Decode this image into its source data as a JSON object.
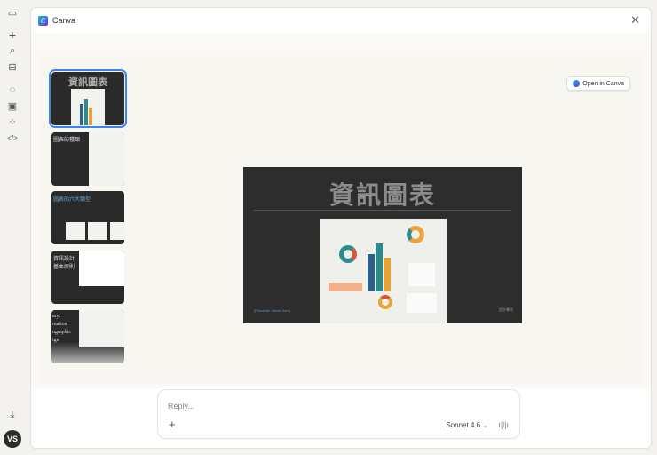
{
  "rail": {
    "icons": [
      "sidebar-toggle-icon",
      "new-chat-icon",
      "search-icon",
      "toolbox-icon",
      "chats-icon",
      "projects-icon",
      "artifacts-icon",
      "code-icon",
      "download-icon"
    ],
    "avatar": "VS"
  },
  "header": {
    "title": "Canva",
    "logo_letter": "C",
    "close": "✕"
  },
  "open_button": "Open in Canva",
  "thumbnails": [
    {
      "title": "資訊圖表"
    },
    {
      "title": "圖表的種類"
    },
    {
      "title": "圖表的六大類型"
    },
    {
      "title": "資訊設計\n基本原則"
    },
    {
      "title": "ary:\nmation\nographic\nign"
    }
  ],
  "slide": {
    "title": "資訊圖表",
    "footer_left": "[Presenter Name Here]",
    "footer_right": "設計專案"
  },
  "reply": {
    "placeholder": "Reply...",
    "plus": "+",
    "model": "Sonnet 4.6",
    "chevron": "⌄",
    "voice": "ı|l|ı"
  },
  "colors": {
    "accent": "#3b82f6",
    "slide_bg": "#2d2d2d",
    "teal": "#2a8c8c",
    "orange": "#e8a33a",
    "navy": "#2f5f86",
    "red": "#d9553a"
  }
}
